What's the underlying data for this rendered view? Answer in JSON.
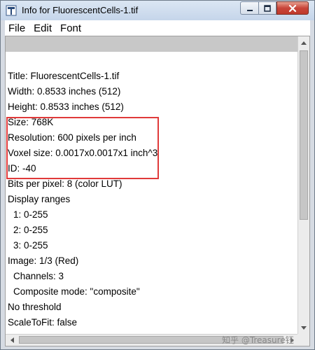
{
  "window": {
    "title": "Info for FluorescentCells-1.tif"
  },
  "menu": {
    "items": [
      "File",
      "Edit",
      "Font"
    ]
  },
  "info_lines": [
    "Title: FluorescentCells-1.tif",
    "Width:  0.8533 inches (512)",
    "Height:  0.8533 inches (512)",
    "Size:  768K",
    "Resolution:  600 pixels per inch",
    "Voxel size: 0.0017x0.0017x1 inch^3",
    "ID: -40",
    "Bits per pixel: 8 (color LUT)",
    "Display ranges",
    "1: 0-255",
    "2: 0-255",
    "3: 0-255",
    "Image: 1/3 (Red)",
    "Channels: 3",
    "Composite mode: \"composite\"",
    "No threshold",
    "ScaleToFit: false"
  ],
  "watermark": "知乎 @Treasure钰",
  "colors": {
    "highlight": "#e03a3a",
    "titlebar": "#c5d5ea",
    "close_button": "#c8453a"
  },
  "icons": {
    "app": "imagej-document-icon",
    "minimize": "minimize-icon",
    "maximize": "maximize-icon",
    "close": "close-icon"
  }
}
